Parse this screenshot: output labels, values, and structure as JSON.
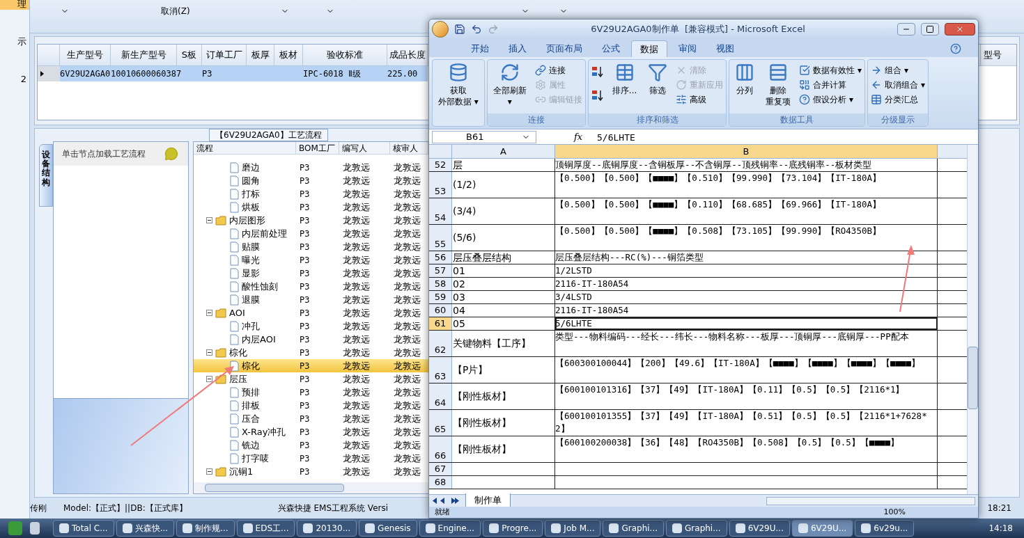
{
  "nav": {
    "items": [
      {
        "label": "理",
        "selected": true
      },
      {
        "label": "示",
        "selected": false
      },
      {
        "label": "2",
        "selected": false
      }
    ]
  },
  "toolbar": {
    "cancel": "取消(Z)"
  },
  "order_grid": {
    "columns": [
      "生产型号",
      "新生产型号",
      "S板",
      "订单工厂",
      "板厚",
      "板材",
      "验收标准",
      "成品长度"
    ],
    "last_column": "型号",
    "rows": [
      {
        "selected": true,
        "cells": [
          "6V29U2AGA0",
          "10010600060387",
          "",
          "P3",
          "",
          "",
          "IPC-6018 Ⅱ级",
          "225.00"
        ]
      }
    ]
  },
  "flow_tab": "【6V29U2AGA0】工艺流程",
  "side_panel": {
    "tab": "设备结构",
    "hint": "单击节点加载工艺流程"
  },
  "tree": {
    "columns": [
      "流程",
      "BOM工厂",
      "编写人",
      "核审人"
    ],
    "rows": [
      {
        "kind": "file",
        "label": "磨边",
        "bom": "P3",
        "writer": "龙敦远",
        "reviewer": "龙敦远",
        "selected": false
      },
      {
        "kind": "file",
        "label": "圆角",
        "bom": "P3",
        "writer": "龙敦远",
        "reviewer": "龙敦远",
        "selected": false
      },
      {
        "kind": "file",
        "label": "打标",
        "bom": "P3",
        "writer": "龙敦远",
        "reviewer": "龙敦远",
        "selected": false
      },
      {
        "kind": "file",
        "label": "烘板",
        "bom": "P3",
        "writer": "龙敦远",
        "reviewer": "龙敦远",
        "selected": false
      },
      {
        "kind": "folder",
        "label": "内层图形",
        "bom": "P3",
        "writer": "龙敦远",
        "reviewer": "龙敦远",
        "selected": false,
        "expanded": true,
        "children": [
          {
            "kind": "file",
            "label": "内层前处理",
            "bom": "P3",
            "writer": "龙敦远",
            "reviewer": "龙敦远",
            "selected": false
          },
          {
            "kind": "file",
            "label": "贴膜",
            "bom": "P3",
            "writer": "龙敦远",
            "reviewer": "龙敦远",
            "selected": false
          },
          {
            "kind": "file",
            "label": "曝光",
            "bom": "P3",
            "writer": "龙敦远",
            "reviewer": "龙敦远",
            "selected": false
          },
          {
            "kind": "file",
            "label": "显影",
            "bom": "P3",
            "writer": "龙敦远",
            "reviewer": "龙敦远",
            "selected": false
          },
          {
            "kind": "file",
            "label": "酸性蚀刻",
            "bom": "P3",
            "writer": "龙敦远",
            "reviewer": "龙敦远",
            "selected": false
          },
          {
            "kind": "file",
            "label": "退膜",
            "bom": "P3",
            "writer": "龙敦远",
            "reviewer": "龙敦远",
            "selected": false
          }
        ]
      },
      {
        "kind": "folder",
        "label": "AOI",
        "bom": "P3",
        "writer": "龙敦远",
        "reviewer": "龙敦远",
        "selected": false,
        "expanded": true,
        "children": [
          {
            "kind": "file",
            "label": "冲孔",
            "bom": "P3",
            "writer": "龙敦远",
            "reviewer": "龙敦远",
            "selected": false
          },
          {
            "kind": "file",
            "label": "内层AOI",
            "bom": "P3",
            "writer": "龙敦远",
            "reviewer": "龙敦远",
            "selected": false
          }
        ]
      },
      {
        "kind": "folder",
        "label": "棕化",
        "bom": "P3",
        "writer": "龙敦远",
        "reviewer": "龙敦远",
        "selected": false,
        "expanded": true,
        "children": [
          {
            "kind": "file",
            "label": "棕化",
            "bom": "P3",
            "writer": "龙敦远",
            "reviewer": "龙敦远",
            "selected": true
          }
        ]
      },
      {
        "kind": "folder",
        "label": "层压",
        "bom": "P3",
        "writer": "龙敦远",
        "reviewer": "龙敦远",
        "selected": false,
        "expanded": true,
        "children": [
          {
            "kind": "file",
            "label": "预排",
            "bom": "P3",
            "writer": "龙敦远",
            "reviewer": "龙敦远",
            "selected": false
          },
          {
            "kind": "file",
            "label": "排板",
            "bom": "P3",
            "writer": "龙敦远",
            "reviewer": "龙敦远",
            "selected": false
          },
          {
            "kind": "file",
            "label": "压合",
            "bom": "P3",
            "writer": "龙敦远",
            "reviewer": "龙敦远",
            "selected": false
          },
          {
            "kind": "file",
            "label": "X-Ray冲孔",
            "bom": "P3",
            "writer": "龙敦远",
            "reviewer": "龙敦远",
            "selected": false
          },
          {
            "kind": "file",
            "label": "铣边",
            "bom": "P3",
            "writer": "龙敦远",
            "reviewer": "龙敦远",
            "selected": false
          },
          {
            "kind": "file",
            "label": "打字唛",
            "bom": "P3",
            "writer": "龙敦远",
            "reviewer": "龙敦远",
            "selected": false
          }
        ]
      },
      {
        "kind": "folder",
        "label": "沉铜1",
        "bom": "P3",
        "writer": "龙敦远",
        "reviewer": "龙敦远",
        "selected": false,
        "expanded": true
      }
    ]
  },
  "status_bar": {
    "user": "传刚",
    "model": "Model:【正式】||DB:【正式库】",
    "system": "兴森快捷 EMS工程系统 Versi",
    "time": "18:21"
  },
  "excel": {
    "title": "6V29U2AGA0制作单  [兼容模式] - Microsoft Excel",
    "tabs": [
      {
        "label": "开始",
        "selected": false
      },
      {
        "label": "插入",
        "selected": false
      },
      {
        "label": "页面布局",
        "selected": false
      },
      {
        "label": "公式",
        "selected": false
      },
      {
        "label": "数据",
        "selected": true
      },
      {
        "label": "审阅",
        "selected": false
      },
      {
        "label": "视图",
        "selected": false
      }
    ],
    "groups": [
      {
        "commands": [
          {
            "kind": "large",
            "lines": [
              "获取",
              "外部数据 ▾"
            ],
            "disabled": false
          }
        ]
      },
      {
        "title": "连接",
        "commands": [
          {
            "kind": "large",
            "lines": [
              "全部刷新",
              "▾"
            ],
            "disabled": false
          },
          {
            "kind": "small",
            "label": "连接",
            "disabled": false
          },
          {
            "kind": "small",
            "label": "属性",
            "disabled": true
          },
          {
            "kind": "small",
            "label": "编辑链接",
            "disabled": true
          }
        ]
      },
      {
        "title": "排序和筛选",
        "commands": [
          {
            "kind": "sort",
            "disabled": false
          },
          {
            "kind": "large",
            "lines": [
              "排序..."
            ],
            "disabled": false
          },
          {
            "kind": "large",
            "lines": [
              "筛选"
            ],
            "disabled": false
          },
          {
            "kind": "small",
            "label": "清除",
            "disabled": true
          },
          {
            "kind": "small",
            "label": "重新应用",
            "disabled": true
          },
          {
            "kind": "small",
            "label": "高级",
            "disabled": false
          }
        ]
      },
      {
        "title": "数据工具",
        "commands": [
          {
            "kind": "large",
            "lines": [
              "分列"
            ],
            "disabled": false
          },
          {
            "kind": "large",
            "lines": [
              "删除",
              "重复项"
            ],
            "disabled": false
          },
          {
            "kind": "small",
            "label": "数据有效性 ▾",
            "disabled": false
          },
          {
            "kind": "small",
            "label": "合并计算",
            "disabled": false
          },
          {
            "kind": "small",
            "label": "假设分析 ▾",
            "disabled": false
          }
        ]
      },
      {
        "title": "分级显示",
        "commands": [
          {
            "kind": "small",
            "label": "组合 ▾",
            "disabled": false
          },
          {
            "kind": "small",
            "label": "取消组合 ▾",
            "disabled": false
          },
          {
            "kind": "small",
            "label": "分类汇总",
            "disabled": false
          }
        ]
      }
    ],
    "name_box": "B61",
    "fx_label": "fx",
    "formula": "5/6LHTE",
    "columns": [
      "A",
      "B"
    ],
    "rows": [
      {
        "num": "52",
        "a": "层",
        "b": "顶铜厚度--底铜厚度--含铜板厚--不含铜厚--顶残铜率--底残铜率--板材类型",
        "tall": false,
        "selected": false
      },
      {
        "num": "53",
        "a": "(1/2)",
        "b": "【0.500】【0.500】【■■■■】【0.510】【99.990】【73.104】【IT-180A】",
        "tall": true,
        "selected": false
      },
      {
        "num": "54",
        "a": "(3/4)",
        "b": "【0.500】【0.500】【■■■■】【0.110】【68.685】【69.966】【IT-180A】",
        "tall": true,
        "selected": false
      },
      {
        "num": "55",
        "a": "(5/6)",
        "b": "【0.500】【0.500】【■■■■】【0.508】【73.105】【99.990】【RO4350B】",
        "tall": true,
        "selected": false
      },
      {
        "num": "56",
        "a": "层压叠层结构",
        "b": "层压叠层结构---RC(%)---铜箔类型",
        "tall": false,
        "selected": false
      },
      {
        "num": "57",
        "a": "01",
        "b": "1/2LSTD",
        "tall": false,
        "selected": false
      },
      {
        "num": "58",
        "a": "02",
        "b": "2116-IT-180A54",
        "tall": false,
        "selected": false
      },
      {
        "num": "59",
        "a": "03",
        "b": "3/4LSTD",
        "tall": false,
        "selected": false
      },
      {
        "num": "60",
        "a": "04",
        "b": "2116-IT-180A54",
        "tall": false,
        "selected": false
      },
      {
        "num": "61",
        "a": "05",
        "b": "5/6LHTE",
        "tall": false,
        "selected": true
      },
      {
        "num": "62",
        "a": "关键物料【工序】",
        "b": "类型---物料编码---经长---纬长---物料名称---板厚---顶铜厚---底铜厚---PP配本",
        "tall": true,
        "selected": false
      },
      {
        "num": "63",
        "a": "【P片】",
        "b": "【600300100044】【200】【49.6】【IT-180A】【■■■■】【■■■■】【■■■■】【■■■■】",
        "tall": true,
        "selected": false
      },
      {
        "num": "64",
        "a": "【刚性板材】",
        "b": "【600100101316】【37】【49】【IT-180A】【0.11】【0.5】【0.5】【2116*1】",
        "tall": true,
        "selected": false
      },
      {
        "num": "65",
        "a": "【刚性板材】",
        "b": "【600100101355】【37】【49】【IT-180A】【0.51】【0.5】【0.5】【2116*1+7628*2】",
        "tall": true,
        "selected": false
      },
      {
        "num": "66",
        "a": "【刚性板材】",
        "b": "【600100200038】【36】【48】【RO4350B】【0.508】【0.5】【0.5】【■■■■】",
        "tall": true,
        "selected": false
      },
      {
        "num": "67",
        "a": "",
        "b": "",
        "tall": false,
        "selected": false
      },
      {
        "num": "68",
        "a": "",
        "b": "",
        "tall": false,
        "selected": false
      }
    ],
    "sheet_tab": "制作单",
    "status": "就绪",
    "zoom": "100%"
  },
  "taskbar": {
    "items": [
      {
        "label": "Total C...",
        "active": false
      },
      {
        "label": "兴森快...",
        "active": false
      },
      {
        "label": "制作规...",
        "active": false
      },
      {
        "label": "EDS工...",
        "active": false
      },
      {
        "label": "20130...",
        "active": false
      },
      {
        "label": "Genesis",
        "active": false
      },
      {
        "label": "Engine...",
        "active": false
      },
      {
        "label": "Progre...",
        "active": false
      },
      {
        "label": "Job M...",
        "active": false
      },
      {
        "label": "Graphi...",
        "active": false
      },
      {
        "label": "Graphi...",
        "active": false
      },
      {
        "label": "6V29U...",
        "active": false
      },
      {
        "label": "6V29U...",
        "active": true
      },
      {
        "label": "6v29u...",
        "active": false
      }
    ],
    "time": "14:18"
  }
}
